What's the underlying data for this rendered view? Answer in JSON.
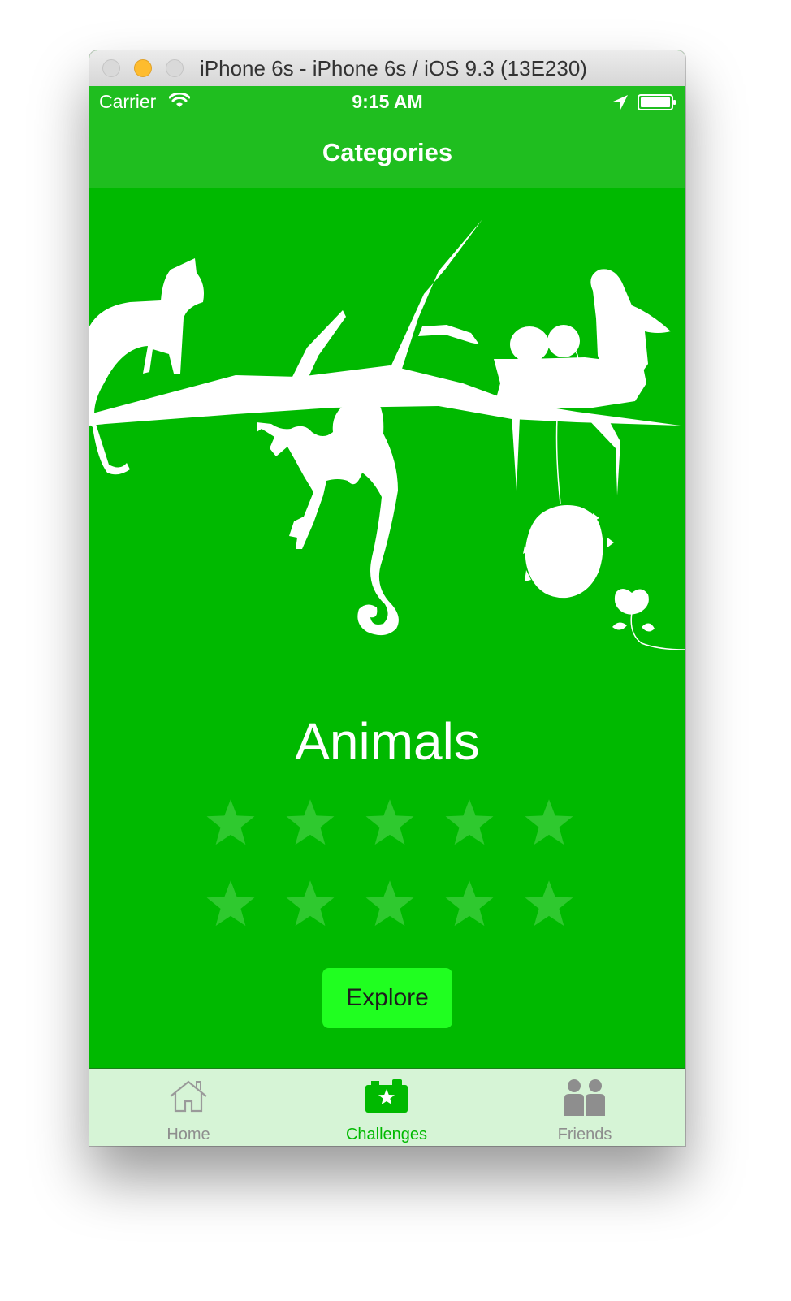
{
  "window": {
    "title": "iPhone 6s - iPhone 6s / iOS 9.3 (13E230)"
  },
  "status_bar": {
    "carrier": "Carrier",
    "time": "9:15 AM",
    "icons": [
      "wifi-icon",
      "location-arrow-icon",
      "battery-icon"
    ]
  },
  "nav": {
    "title": "Categories"
  },
  "category": {
    "name": "Animals",
    "illustration": "animals-tree-silhouette",
    "stars_earned": 0,
    "stars_total": 10,
    "explore_label": "Explore"
  },
  "tabs": [
    {
      "label": "Home",
      "icon": "home-icon",
      "selected": false
    },
    {
      "label": "Challenges",
      "icon": "camera-star-icon",
      "selected": true
    },
    {
      "label": "Friends",
      "icon": "friends-icon",
      "selected": false
    }
  ],
  "colors": {
    "background": "#00b900",
    "nav_bar": "#1fbe1f",
    "button": "#20ff20",
    "star_empty": "#2fc92f",
    "tab_selected": "#00b900",
    "tab_unselected": "#8e8e8e",
    "tab_bar": "#d6f4d6"
  }
}
